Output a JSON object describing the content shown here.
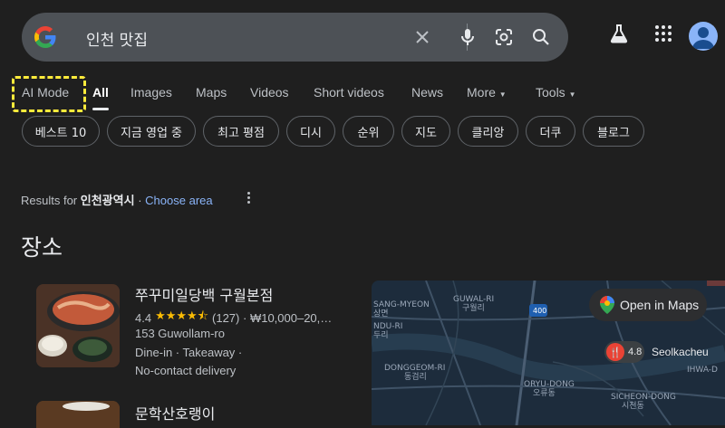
{
  "search": {
    "query": "인천 맛집",
    "icons": [
      "google-g-icon",
      "close-icon",
      "mic-icon",
      "camera-lens-icon",
      "search-icon"
    ]
  },
  "header_icons": [
    "labs-flask-icon",
    "apps-grid-icon",
    "account-avatar-icon"
  ],
  "tabs": [
    {
      "label": "AI Mode",
      "active": false
    },
    {
      "label": "All",
      "active": true
    },
    {
      "label": "Images",
      "active": false
    },
    {
      "label": "Maps",
      "active": false
    },
    {
      "label": "Videos",
      "active": false
    },
    {
      "label": "Short videos",
      "active": false
    },
    {
      "label": "News",
      "active": false
    },
    {
      "label": "More",
      "active": false
    },
    {
      "label": "Tools",
      "active": false
    }
  ],
  "chips": [
    "베스트 10",
    "지금 영업 중",
    "최고 평점",
    "디시",
    "순위",
    "지도",
    "클리앙",
    "더쿠",
    "블로그"
  ],
  "results_for": {
    "prefix": "Results for",
    "location": "인천광역시",
    "separator": "·",
    "link": "Choose area"
  },
  "section_title": "장소",
  "places": [
    {
      "name": "쭈꾸미일당백 구월본점",
      "rating": "4.4",
      "stars": "★★★★⯪",
      "reviews": "(127)",
      "price": "· ₩10,000–20,…",
      "address": "153 Guwollam-ro",
      "services": "Dine-in · Takeaway ·",
      "services2": "No-contact delivery"
    },
    {
      "name": "문학산호랭이"
    }
  ],
  "map": {
    "open_label": "Open in Maps",
    "pin_rating": "4.8",
    "pin_name": "Seolkacheu",
    "road_number": "400",
    "labels": {
      "sangmyeon": "SANG-MYEON",
      "sangmyeon_ko": "상면",
      "guwolri": "GUWAL-RI",
      "guwolri_ko": "구월리",
      "nduri": "NDU-RI",
      "nduri_ko": "두리",
      "donggeom": "DONGGEOM-RI",
      "donggeom_ko": "동검리",
      "oryu": "ORYU-DONG",
      "oryu_ko": "오류동",
      "sicheon": "SICHEON-DONG",
      "sicheon_ko": "시천동",
      "ihwa": "IHWA-D"
    }
  },
  "colors": {
    "background": "#1f1f1f",
    "searchbar": "#4d5156",
    "link": "#8ab4f8",
    "star": "#fbbc04",
    "highlight": "#ffeb3b"
  }
}
